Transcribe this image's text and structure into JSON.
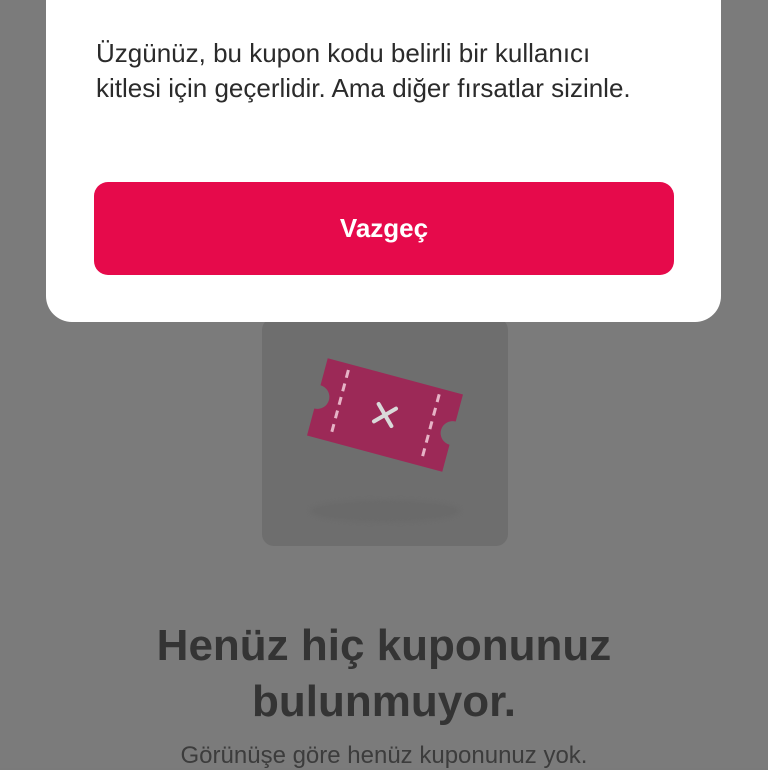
{
  "dialog": {
    "message": "Üzgünüz, bu kupon kodu belirli bir kullanıcı kitlesi için geçerlidir. Ama diğer fırsatlar sizinle.",
    "button_label": "Vazgeç"
  },
  "empty_state": {
    "title": "Henüz hiç kuponunuz\nbulunmuyor.",
    "subtitle": "Görünüşe göre henüz kuponunuz yok.",
    "icon": "ticket-x-icon"
  },
  "colors": {
    "accent": "#e60a4b",
    "ticket": "#c0245f",
    "overlay": "#7b7b7b"
  }
}
